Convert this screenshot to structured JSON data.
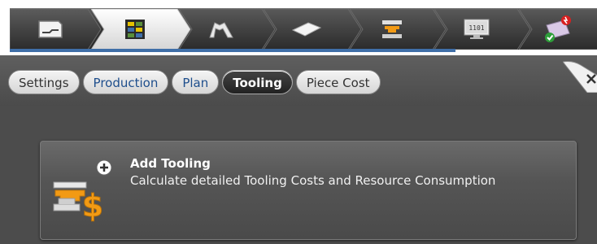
{
  "steps": [
    {
      "name": "part",
      "icon": "part-outline-icon"
    },
    {
      "name": "nesting",
      "icon": "nesting-grid-icon"
    },
    {
      "name": "forming",
      "icon": "forming-arch-icon"
    },
    {
      "name": "sheet",
      "icon": "flat-sheet-icon"
    },
    {
      "name": "press",
      "icon": "press-machine-icon"
    },
    {
      "name": "nc-program",
      "icon": "nc-monitor-icon",
      "text": "1101"
    },
    {
      "name": "status",
      "icon": "status-check-icon"
    }
  ],
  "tabs": [
    {
      "label": "Settings",
      "state": "normal"
    },
    {
      "label": "Production",
      "state": "blue"
    },
    {
      "label": "Plan",
      "state": "blue"
    },
    {
      "label": "Tooling",
      "state": "active"
    },
    {
      "label": "Piece Cost",
      "state": "normal"
    }
  ],
  "add_tooling": {
    "title": "Add Tooling",
    "description": "Calculate detailed Tooling Costs and Resource Consumption",
    "icon_symbol": "$"
  },
  "colors": {
    "accent_blue": "#3f6fa8",
    "dollar_orange": "#f29a14",
    "active_step": "#f2f2f2"
  }
}
